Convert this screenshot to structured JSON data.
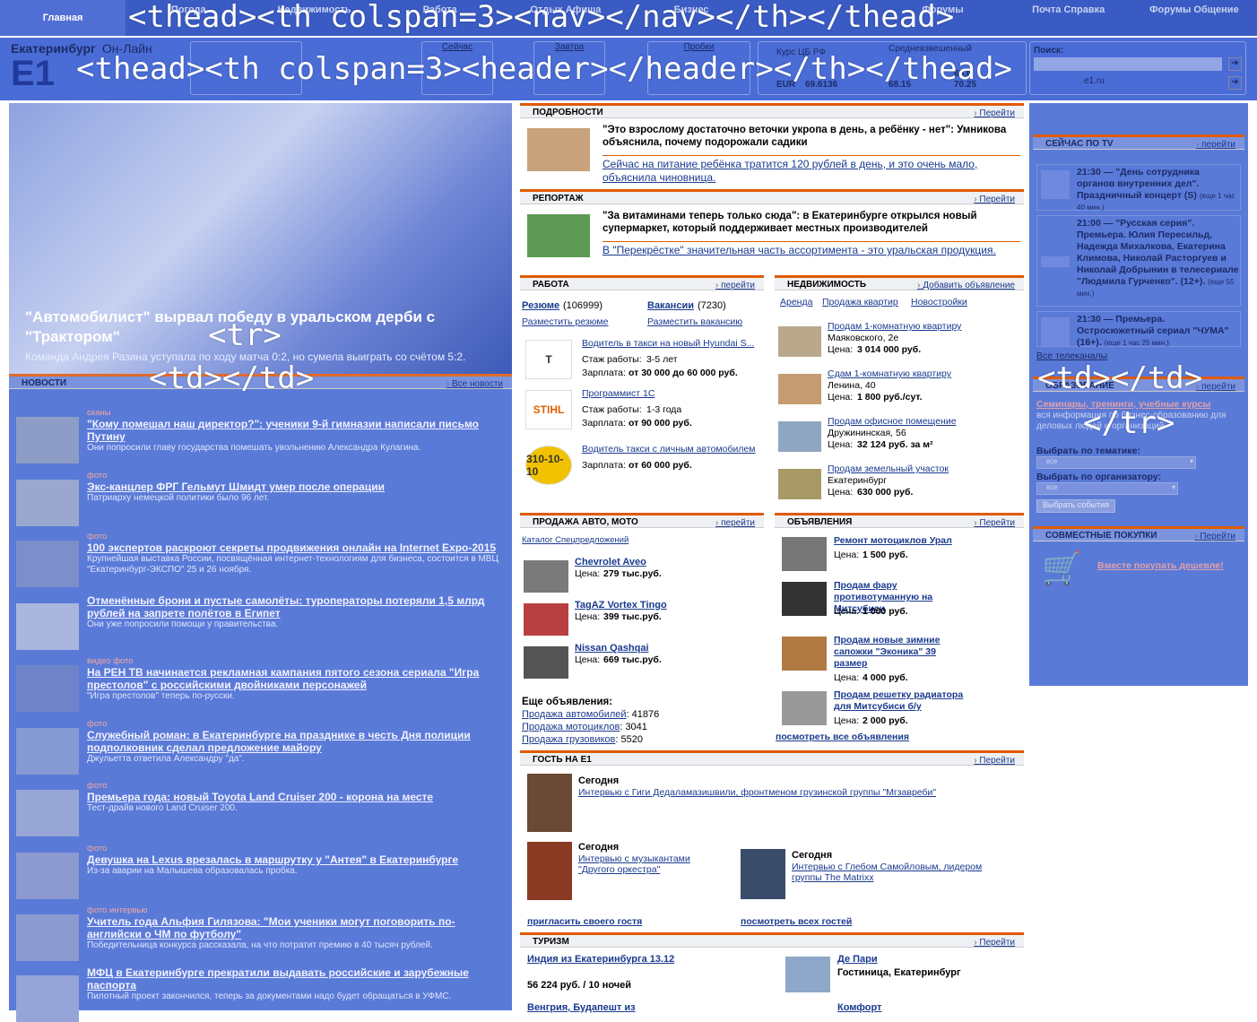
{
  "overlay_tags": {
    "nav": "<thead><th colspan=3><nav></nav></th></thead>",
    "header": "<thead><th colspan=3><header></header></th></thead>",
    "tr_open": "<tr>",
    "td_left": "<td></td>",
    "td_right": "<td></td>",
    "tr_close": "</tr>"
  },
  "nav": {
    "tabs": [
      "Главная",
      "Погода",
      "Недвижимость",
      "Работа",
      "Отдых Афиша",
      "Бизнес",
      "",
      "Форумы",
      "Почта Справка",
      "Форумы Общение"
    ]
  },
  "header": {
    "logo_city": "Екатеринбург",
    "logo_online": "Он-Лайн",
    "logo_mark": "E1",
    "weather_label": "Сейчас",
    "tomorrow_label": "Завтра",
    "traffic_label": "Пробки",
    "rate_label": "Курс ЦБ РФ",
    "avg_label": "Средневзвешенный",
    "eur_label": "EUR",
    "eur_value": "69.6136",
    "rate2": "68.15",
    "rate3": "70.25",
    "rate_usd": "65.6",
    "search_label": "Поиск:",
    "search_site": "e1.ru"
  },
  "lead": {
    "title": "\"Автомобилист\" вырвал победу в уральском дерби с \"Трактором\"",
    "sub": "Команда Андрея Разина уступала по ходу матча 0:2, но сумела выиграть со счётом 5:2."
  },
  "news": {
    "section": "НОВОСТИ",
    "more": "Все новости",
    "items": [
      {
        "tag": "сканы",
        "title": "\"Кому помешал наш директор?\": ученики 9-й гимназии написали письмо Путину",
        "sub": "Они попросили главу государства помешать увольнению Александра Кулагина."
      },
      {
        "tag": "фото",
        "title": "Экс-канцлер ФРГ Гельмут Шмидт умер после операции",
        "sub": "Патриарху немецкой политики было 96 лет."
      },
      {
        "tag": "фото",
        "title": "100 экспертов раскроют секреты продвижения онлайн на Internet Expo-2015",
        "sub": "Крупнейшая выставка России, посвящённая интернет-технологиям для бизнеса, состоится в МВЦ \"Екатеринбург-ЭКСПО\" 25 и 26 ноября."
      },
      {
        "tag": "",
        "title": "Отменённые брони и пустые самолёты: туроператоры потеряли 1,5 млрд рублей на запрете полётов в Египет",
        "sub": "Они уже попросили помощи у правительства."
      },
      {
        "tag": "видео  фото",
        "title": "На РЕН ТВ начинается рекламная кампания пятого сезона сериала \"Игра престолов\" с российскими двойниками персонажей",
        "sub": "\"Игра престолов\" теперь по-русски."
      },
      {
        "tag": "фото",
        "title": "Служебный роман: в Екатеринбурге на празднике в честь Дня полиции подполковник сделал предложение майору",
        "sub": "Джульетта ответила Александру \"да\"."
      },
      {
        "tag": "фото",
        "title": "Премьера года: новый Toyota Land Cruiser 200 - корона на месте",
        "sub": "Тест-драйв нового Land Cruiser 200."
      },
      {
        "tag": "фото",
        "title": "Девушка на Lexus врезалась в маршрутку у \"Антея\" в Екатеринбурге",
        "sub": "Из-за аварии на Малышева образовалась пробка."
      },
      {
        "tag": "фото  интервью",
        "title": "Учитель года Альфия Гилязова: \"Мои ученики могут поговорить по-английски о ЧМ по футболу\"",
        "sub": "Победительница конкурса рассказала, на что потратит премию в 40 тысяч рублей."
      },
      {
        "tag": "",
        "title": "МФЦ в Екатеринбурге прекратили выдавать российские и зарубежные паспорта",
        "sub": "Пилотный проект закончился, теперь за документами надо будет обращаться в УФМС."
      }
    ]
  },
  "details": {
    "section": "ПОДРОБНОСТИ",
    "more": "Перейти",
    "title": "\"Это взрослому достаточно веточки укропа в день, а ребёнку - нет\": Умникова объяснила, почему подорожали садики",
    "link": "Сейчас на питание ребёнка тратится 120 рублей в день, и это очень мало, объяснила чиновница."
  },
  "report": {
    "section": "РЕПОРТАЖ",
    "more": "Перейти",
    "title": "\"За витаминами теперь только сюда\": в Екатеринбурге открылся новый супермаркет, который поддерживает местных производителей",
    "link": "В \"Перекрёстке\" значительная часть ассортимента - это уральская продукция."
  },
  "jobs": {
    "section": "РАБОТА",
    "more": "перейти",
    "resume": "Резюме",
    "resume_count": "(106999)",
    "vac": "Вакансии",
    "vac_count": "(7230)",
    "post_resume": "Разместить резюме",
    "post_vac": "Разместить вакансию",
    "items": [
      {
        "logo": "T",
        "title": "Водитель в такси на новый Hyundai S...",
        "exp_label": "Стаж работы:",
        "exp": "3-5 лет",
        "pay_label": "Зарплата:",
        "pay": "от 30 000 до 60 000 руб."
      },
      {
        "logo": "STIHL",
        "title": "Программист 1С",
        "exp_label": "Стаж работы:",
        "exp": "1-3 года",
        "pay_label": "Зарплата:",
        "pay": "от 90 000 руб."
      },
      {
        "logo": "310-10-10",
        "title": "Водитель такси с личным автомобилем",
        "exp_label": "",
        "exp": "",
        "pay_label": "Зарплата:",
        "pay": "от 60 000 руб."
      }
    ]
  },
  "realty": {
    "section": "НЕДВИЖИМОСТЬ",
    "more": "Добавить объявление",
    "tabs": [
      "Аренда",
      "Продажа квартир",
      "Новостройки"
    ],
    "items": [
      {
        "title": "Продам 1-комнатную квартиру",
        "addr": "Маяковского, 2е",
        "price_label": "Цена:",
        "price": "3 014 000 руб."
      },
      {
        "title": "Сдам 1-комнатную квартиру",
        "addr": "Ленина, 40",
        "price_label": "Цена:",
        "price": "1 800 руб./сут."
      },
      {
        "title": "Продам офисное помещение",
        "addr": "Дружининская, 56",
        "price_label": "Цена:",
        "price": "32 124 руб. за м²"
      },
      {
        "title": "Продам земельный участок",
        "addr": "Екатеринбург",
        "price_label": "Цена:",
        "price": "630 000 руб."
      }
    ]
  },
  "auto": {
    "section": "ПРОДАЖА АВТО, МОТО",
    "more": "перейти",
    "catalog": "Каталог Спецпредложений",
    "items": [
      {
        "title": "Chevrolet Aveo",
        "price_label": "Цена:",
        "price": "279 тыс.руб."
      },
      {
        "title": "TagAZ Vortex Tingo",
        "price_label": "Цена:",
        "price": "399 тыс.руб."
      },
      {
        "title": "Nissan Qashqai",
        "price_label": "Цена:",
        "price": "669 тыс.руб."
      }
    ],
    "more_label": "Еще объявления:",
    "links": [
      {
        "label": "Продажа автомобилей",
        "count": ": 41876"
      },
      {
        "label": "Продажа мотоциклов",
        "count": ": 3041"
      },
      {
        "label": "Продажа грузовиков",
        "count": ": 5520"
      }
    ]
  },
  "ads": {
    "section": "ОБЪЯВЛЕНИЯ",
    "more": "Перейти",
    "items": [
      {
        "title": "Ремонт мотоциклов Урал",
        "price_label": "Цена:",
        "price": "1 500 руб."
      },
      {
        "title": "Продам фару противотуманную на Митсубиси",
        "price_label": "Цена:",
        "price": "1 000 руб."
      },
      {
        "title": "Продам новые зимние сапожки \"Эконика\" 39 размер",
        "price_label": "Цена:",
        "price": "4 000 руб."
      },
      {
        "title": "Продам решетку радиатора для Митсубиси б/у",
        "price_label": "Цена:",
        "price": "2 000 руб."
      }
    ],
    "all": "посмотреть все объявления"
  },
  "guest": {
    "section": "ГОСТЬ НА E1",
    "more": "Перейти",
    "today": "Сегодня",
    "g1": "Интервью с Гиги Дедаламазишвили, фронтменом грузинской группы \"Мгзавреби\"",
    "g2": "Интервью с музыкантами \"Другого оркестра\"",
    "g3": "Интервью с Глебом Самойловым, лидером группы The Matrixx",
    "invite": "пригласить своего гостя",
    "all": "посмотреть всех гостей"
  },
  "tourism": {
    "section": "ТУРИЗМ",
    "more": "Перейти",
    "t1_title": "Индия из Екатеринбурга 13.12",
    "t1_price": "56 224 руб. / 10 ночей",
    "t2_title": "Де Пари",
    "t2_sub": "Гостиница, Екатеринбург",
    "t3_title": "Венгрия, Будапешт из",
    "t4_title": "Комфорт"
  },
  "tv": {
    "section": "СЕЙЧАС ПО TV",
    "more": "перейти",
    "items": [
      {
        "text": "21:30 — \"День сотрудника органов внутренних дел\". Праздничный концерт (S)",
        "dur": "(еще 1 час 40 мин.)"
      },
      {
        "text": "21:00 — \"Русская серия\". Премьера. Юлия Пересильд, Надежда Михалкова, Екатерина Климова, Николай Расторгуев и Николай Добрынин в телесериале \"Людмила Гурченко\". (12+).",
        "dur": "(еще 55 мин.)"
      },
      {
        "text": "21:30 — Премьера. Остросюжетный сериал \"ЧУМА\" (16+).",
        "dur": "(еще 1 час 25 мин.)"
      }
    ],
    "all": "Все телеканалы"
  },
  "edu": {
    "section": "ОБРАЗОВАНИЕ",
    "more": "перейти",
    "link": "Семинары, тренинги, учебные курсы",
    "desc": "вся информация по бизнес-образованию для деловых людей и организаций",
    "by_topic": "Выбрать по тематике:",
    "by_org": "Выбрать по организатору:",
    "opt": "все",
    "btn": "Выбрать события"
  },
  "joint": {
    "section": "СОВМЕСТНЫЕ ПОКУПКИ",
    "more": "Перейти",
    "link": "Вместе покупать дешевле!"
  }
}
